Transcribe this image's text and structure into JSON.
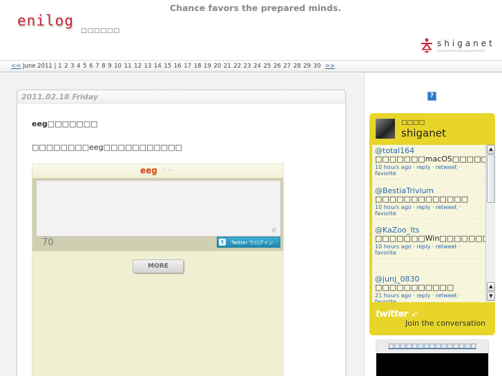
{
  "header": {
    "tagline": "Chance favors the prepared minds.",
    "logo": "enilog",
    "subtitle": "□□□□□□",
    "brand": {
      "name": "shiganet",
      "sub": "Chance favors the prepared minds.",
      "accent_color": "#c8232c"
    }
  },
  "calendar": {
    "prev": "<<",
    "month": "June 2011",
    "separator": "|",
    "days": [
      "1",
      "2",
      "3",
      "4",
      "5",
      "6",
      "7",
      "8",
      "9",
      "10",
      "11",
      "12",
      "13",
      "14",
      "15",
      "16",
      "17",
      "18",
      "19",
      "20",
      "21",
      "22",
      "23",
      "24",
      "25",
      "26",
      "27",
      "28",
      "29",
      "30"
    ],
    "next": ">>"
  },
  "post": {
    "date": "2011.02.18 Friday",
    "title": "eeg□□□□□□□",
    "text": "□□□□□□□□eeg□□□□□□□□□□□"
  },
  "eeg_widget": {
    "logo": "eeg",
    "logo_icon": "sun-cloud-icon",
    "textarea_value": "",
    "char_count": "70",
    "login_label": "Twitter でログイン",
    "more_label": "MORE"
  },
  "sidebar": {
    "help_label": "?",
    "twitter": {
      "real_name": "□□□□",
      "username": "shiganet",
      "tweets": [
        {
          "user": "@total164",
          "text": " □□□□□□□macOS□□□□□□□□□□□□□□□□□",
          "time": "10 hours ago",
          "actions": [
            "reply",
            "retweet",
            "favorite"
          ]
        },
        {
          "user": "@BestiaTrivium",
          "text": " □□□□□□□□□□□□□",
          "time": "10 hours ago",
          "actions": [
            "reply",
            "retweet",
            "favorite"
          ]
        },
        {
          "user": "@KaZoo_lts",
          "text": " □□□□□□□Win□□□□□□□□□□□□□□□□□□□□Win□□□□□□□□□□□□□□□",
          "time": "10 hours ago",
          "actions": [
            "reply",
            "retweet",
            "favorite"
          ]
        },
        {
          "user": "@junj_0830",
          "text": " □□□□□□□□□□□",
          "time": "21 hours ago",
          "actions": [
            "reply",
            "retweet",
            "favorite"
          ]
        }
      ],
      "footer_logo": "twitter",
      "footer_text": "Join the conversation",
      "widget_color": "#e7d52a"
    },
    "ad": {
      "link": "□□□□□□□□□□□□□□□"
    }
  }
}
